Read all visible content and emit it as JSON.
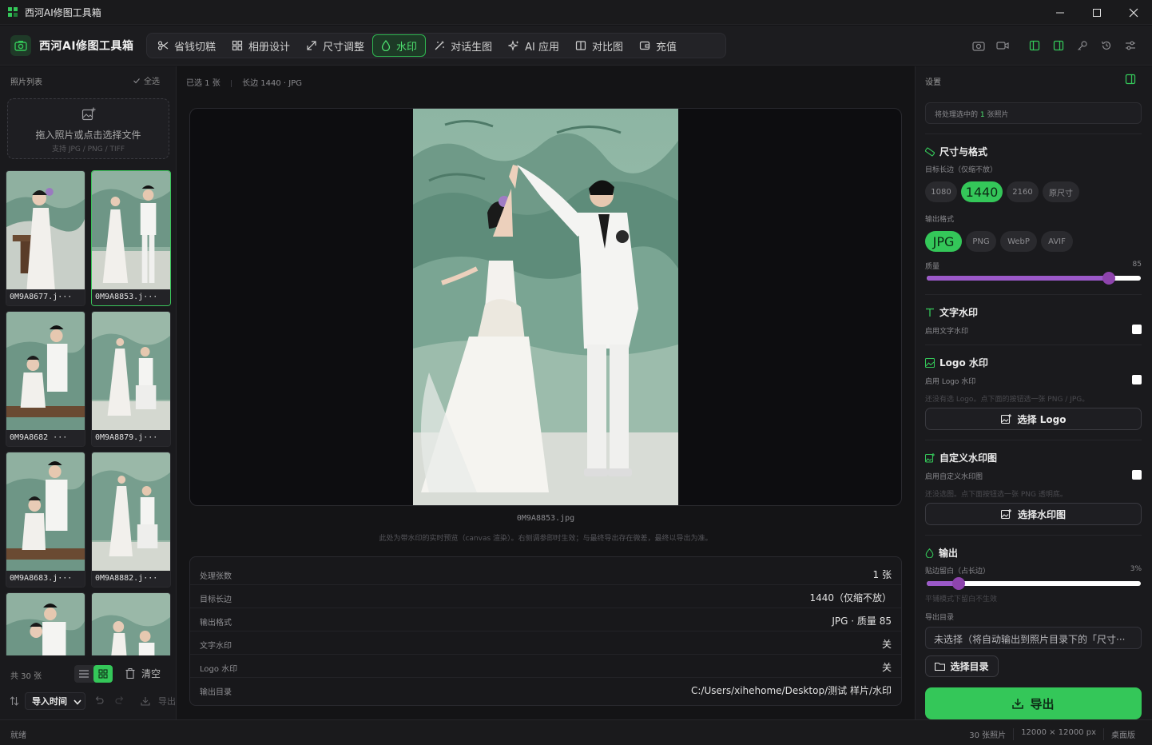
{
  "window": {
    "title": "西河AI修图工具箱"
  },
  "brand": {
    "name": "西河AI修图工具箱"
  },
  "nav": [
    {
      "label": "省钱切糕",
      "icon": "scissors-icon"
    },
    {
      "label": "相册设计",
      "icon": "grid-icon"
    },
    {
      "label": "尺寸调整",
      "icon": "resize-icon"
    },
    {
      "label": "水印",
      "icon": "droplet-icon",
      "active": true
    },
    {
      "label": "对话生图",
      "icon": "magic-wand-icon"
    },
    {
      "label": "AI 应用",
      "icon": "sparkle-icon"
    },
    {
      "label": "对比图",
      "icon": "compare-icon"
    },
    {
      "label": "充值",
      "icon": "wallet-icon"
    }
  ],
  "left": {
    "title": "照片列表",
    "select_all": "全选",
    "drop_main": "拖入照片或点击选择文件",
    "drop_sub": "支持 JPG / PNG / TIFF",
    "photos": [
      {
        "name": "0M9A8677.j···",
        "selected": false
      },
      {
        "name": "0M9A8853.j···",
        "selected": true
      },
      {
        "name": "0M9A8682 ···",
        "selected": false
      },
      {
        "name": "0M9A8879.j···",
        "selected": false
      },
      {
        "name": "0M9A8683.j···",
        "selected": false
      },
      {
        "name": "0M9A8882.j···",
        "selected": false
      },
      {
        "name": "",
        "selected": false
      },
      {
        "name": "",
        "selected": false
      }
    ],
    "count": "共 30 张",
    "clear": "清空",
    "sort": "导入时间",
    "export": "导出"
  },
  "center": {
    "selected": "已选 1 张",
    "meta": "长边 1440 · JPG",
    "filename": "0M9A8853.jpg",
    "note": "此处为带水印的实时预览（canvas 渲染）。右侧调参即时生效；与最终导出存在微差，最终以导出为准。",
    "summary": [
      {
        "k": "处理张数",
        "v": "1 张"
      },
      {
        "k": "目标长边",
        "v": "1440（仅缩不放）"
      },
      {
        "k": "输出格式",
        "v": "JPG · 质量 85"
      },
      {
        "k": "文字水印",
        "v": "关"
      },
      {
        "k": "Logo 水印",
        "v": "关"
      },
      {
        "k": "输出目录",
        "v": "C:/Users/xihehome/Desktop/测试 样片/水印"
      }
    ]
  },
  "right": {
    "title": "设置",
    "process_pre": "将处理选中的 ",
    "process_num": "1",
    "process_post": " 张照片",
    "size_title": "尺寸与格式",
    "size_label": "目标长边（仅缩不放）",
    "sizes": [
      "1080",
      "1440",
      "2160",
      "原尺寸"
    ],
    "size_active": "1440",
    "format_label": "输出格式",
    "formats": [
      "JPG",
      "PNG",
      "WebP",
      "AVIF"
    ],
    "format_active": "JPG",
    "quality_label": "质量",
    "quality_value": "85",
    "quality": 85,
    "text_wm_title": "文字水印",
    "text_wm_enable": "启用文字水印",
    "logo_wm_title": "Logo 水印",
    "logo_wm_enable": "启用 Logo 水印",
    "logo_hint": "还没有选 Logo。点下面的按钮选一张 PNG / JPG。",
    "logo_button": "选择 Logo",
    "custom_wm_title": "自定义水印图",
    "custom_wm_enable": "启用自定义水印图",
    "custom_hint": "还没选图。点下面按钮选一张 PNG 透明底。",
    "custom_button": "选择水印图",
    "output_title": "输出",
    "margin_label": "贴边留白（占长边）",
    "margin_value": "3%",
    "margin": 3,
    "margin_hint": "平铺模式下留白不生效",
    "dir_label": "导出目录",
    "dir_placeholder": "未选择（将自动输出到照片目录下的「尺寸···",
    "dir_button": "选择目录",
    "export_button": "导出"
  },
  "status": {
    "text": "就绪",
    "photos": "30 张照片",
    "resolution": "12000 × 12000 px",
    "edition": "桌面版"
  },
  "colors": {
    "accent": "#34c759",
    "slider": "#9b59c9"
  }
}
